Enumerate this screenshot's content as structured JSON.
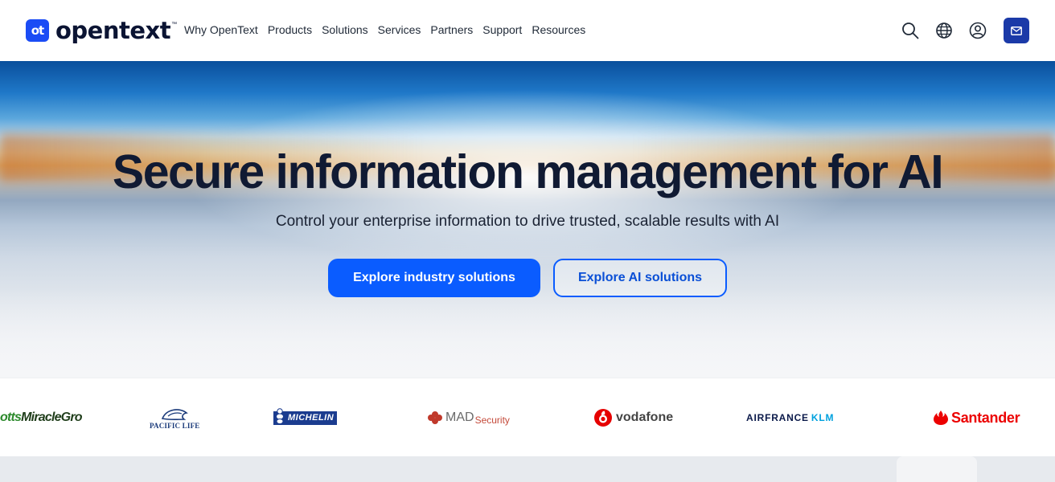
{
  "brand": {
    "logo_mark": "ot",
    "name": "opentext",
    "tm": "™"
  },
  "nav": [
    {
      "label": "Why OpenText"
    },
    {
      "label": "Products"
    },
    {
      "label": "Solutions"
    },
    {
      "label": "Services"
    },
    {
      "label": "Partners"
    },
    {
      "label": "Support"
    },
    {
      "label": "Resources"
    }
  ],
  "header_icons": [
    "search-icon",
    "globe-icon",
    "user-icon",
    "mail-icon"
  ],
  "hero": {
    "title": "Secure information management for AI",
    "subtitle": "Control your enterprise information to drive trusted, scalable results with AI",
    "primary_cta": "Explore industry solutions",
    "secondary_cta": "Explore AI solutions"
  },
  "customer_logos": {
    "scotts": {
      "prefix": "otts",
      "name": "MiracleGro"
    },
    "pacific_life": "PACIFIC LIFE",
    "michelin": "MICHELIN",
    "mad_security": {
      "main": "MAD",
      "suffix": "Security"
    },
    "vodafone": "vodafone",
    "airfrance_klm": {
      "main": "AIRFRANCE",
      "suffix": "KLM"
    },
    "santander": "Santander"
  },
  "colors": {
    "brand_blue": "#1b4cf5",
    "primary_button": "#0a5cff",
    "heading": "#101a33",
    "contact_button": "#1b3aa8"
  }
}
